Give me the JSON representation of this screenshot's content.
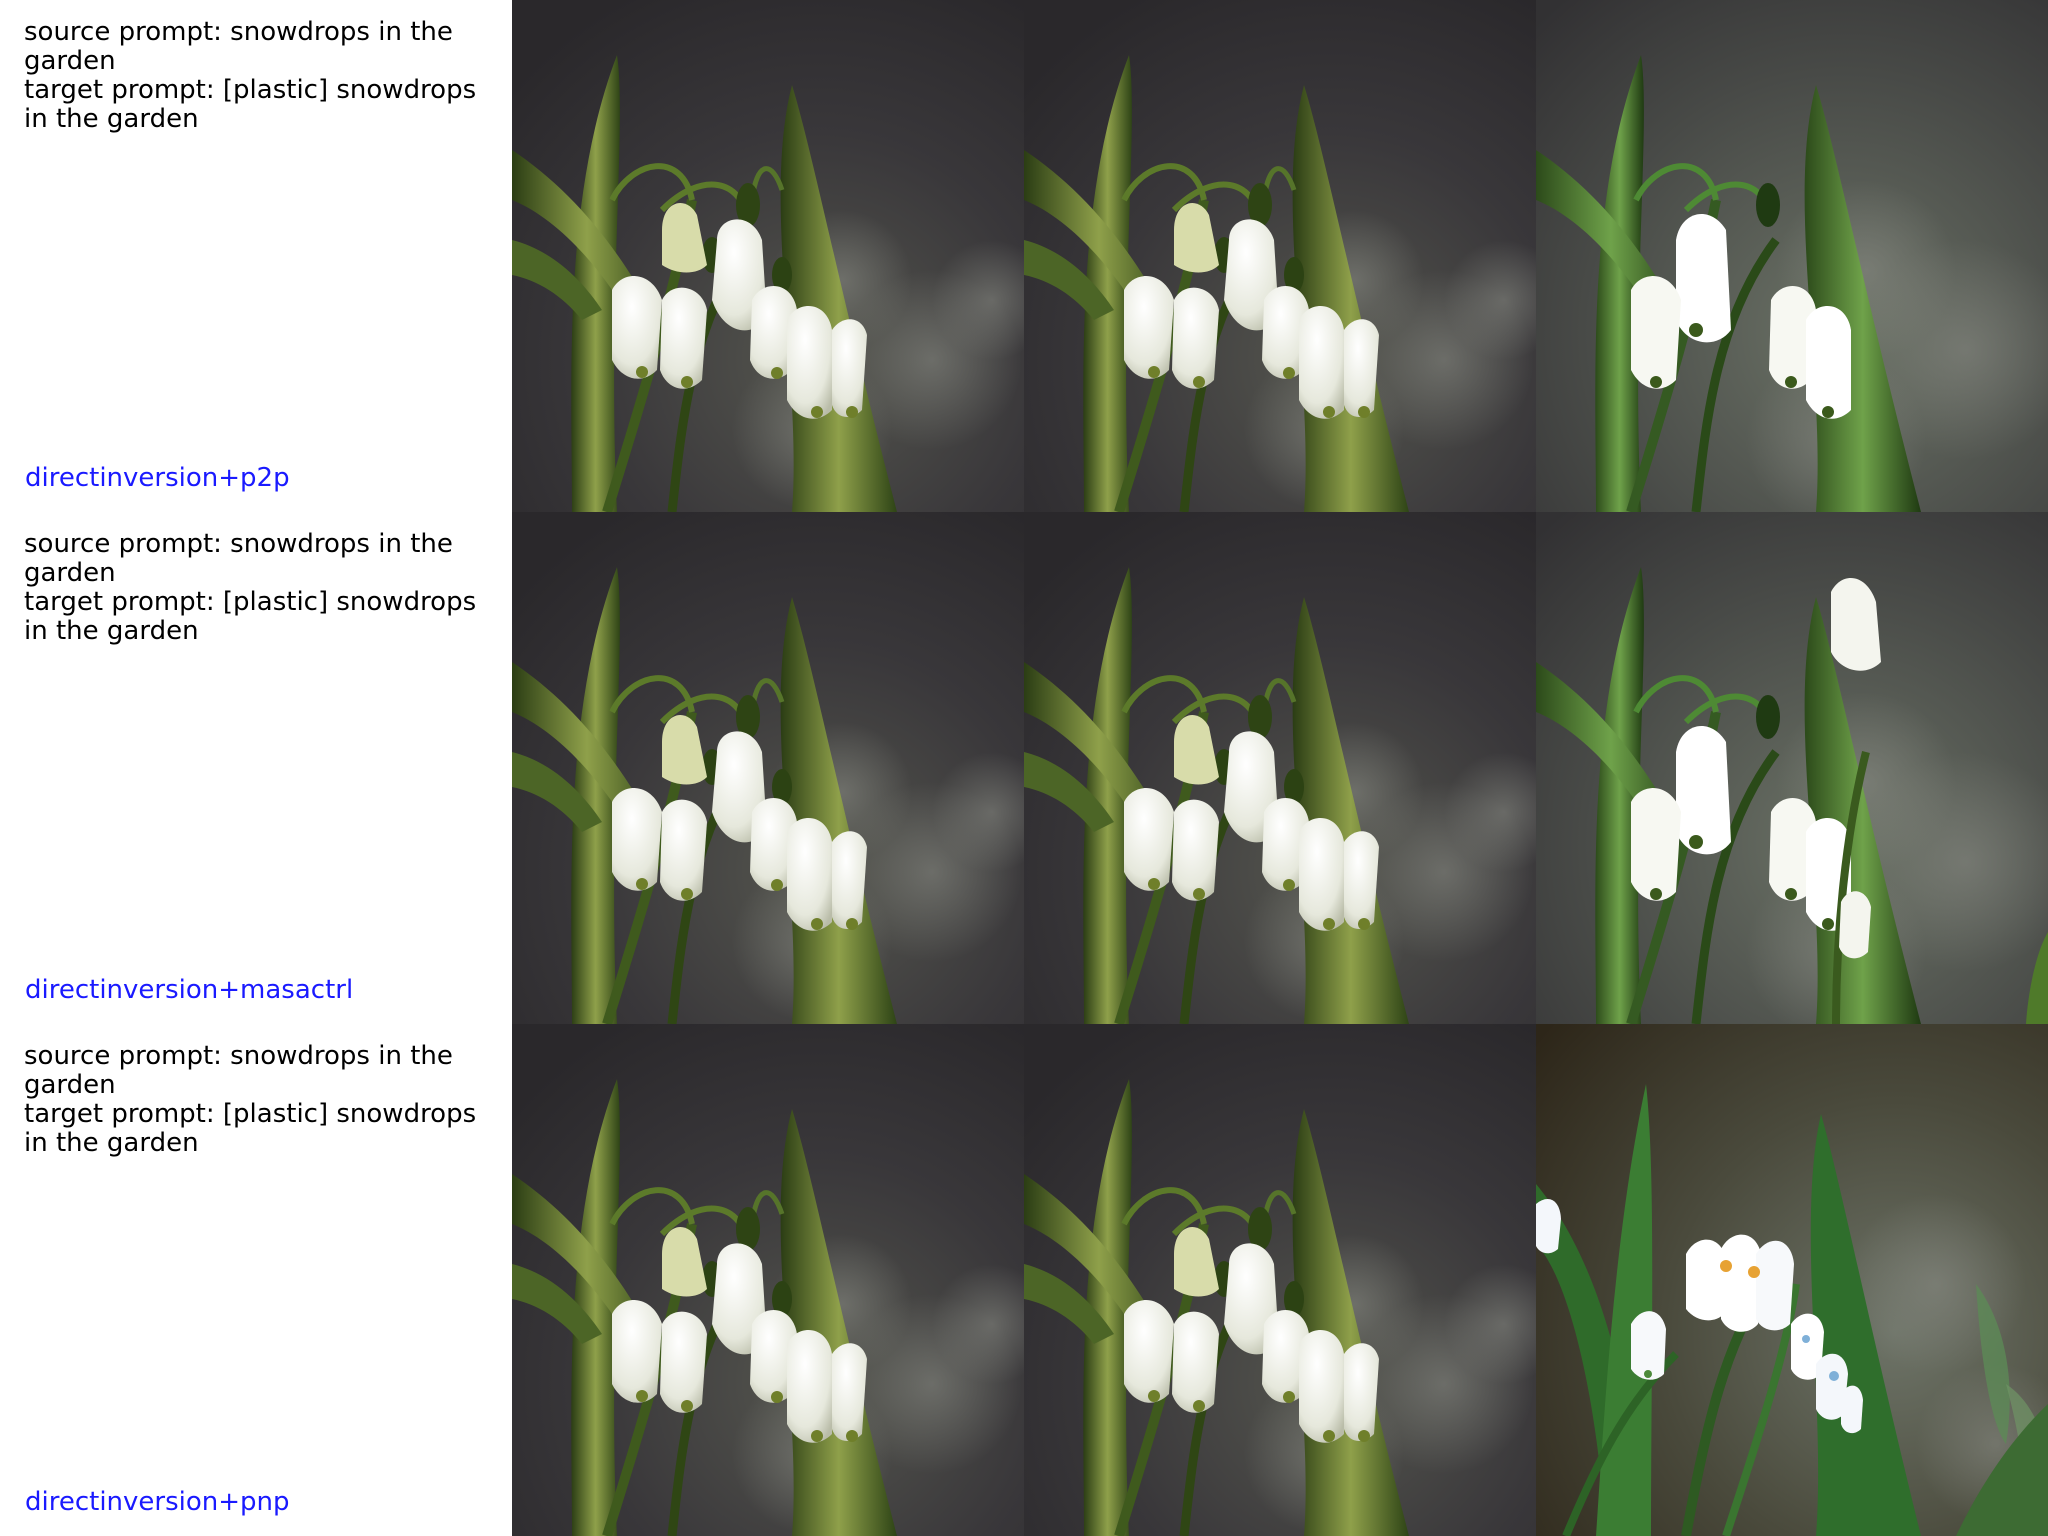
{
  "rows": [
    {
      "source_prompt": "source prompt: snowdrops in the garden",
      "target_prompt": "target prompt: [plastic] snowdrops in the garden",
      "method": "directinversion+p2p"
    },
    {
      "source_prompt": "source prompt: snowdrops in the garden",
      "target_prompt": "target prompt: [plastic] snowdrops in the garden",
      "method": "directinversion+masactrl"
    },
    {
      "source_prompt": "source prompt: snowdrops in the garden",
      "target_prompt": "target prompt: [plastic] snowdrops in the garden",
      "method": "directinversion+pnp"
    }
  ],
  "colors": {
    "method_label": "#1a1aff",
    "background_dark": "#2f2d2f",
    "stem_green": "#3e5a22",
    "petal_white": "#f2f3ee"
  }
}
